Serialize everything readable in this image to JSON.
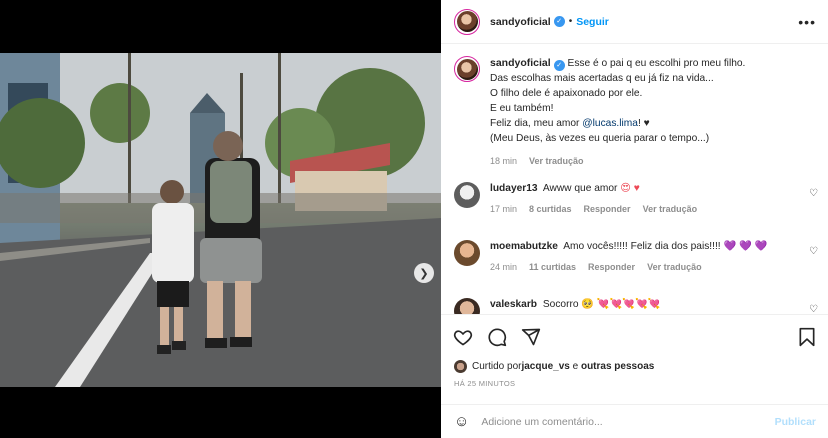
{
  "post": {
    "author": "sandyoficial",
    "follow_label": "Seguir",
    "separator": "•",
    "more_icon": "more-dots-icon"
  },
  "caption": {
    "username": "sandyoficial",
    "lines": [
      "Esse é o pai q eu escolhi pro meu filho.",
      "Das escolhas mais acertadas q eu já fiz na vida...",
      "O filho dele é apaixonado por ele.",
      "E eu também!",
      "(Meu Deus, às vezes eu queria parar o tempo...)"
    ],
    "feliz_prefix": "Feliz dia, meu amor ",
    "mention": "@lucas.lima",
    "feliz_suffix": "! ♥",
    "time": "18 min",
    "translate": "Ver tradução"
  },
  "comments": [
    {
      "username": "ludayer13",
      "text": "Awww que amor",
      "emojis": "😍 ♥",
      "time": "17 min",
      "likes": "8 curtidas",
      "reply": "Responder",
      "translate": "Ver tradução"
    },
    {
      "username": "moemabutzke",
      "text": "Amo vocês!!!!! Feliz dia dos pais!!!!",
      "emojis": "💜 💜 💜",
      "time": "24 min",
      "likes": "11 curtidas",
      "reply": "Responder",
      "translate": "Ver tradução"
    },
    {
      "username": "valeskarb",
      "text": "Socorro",
      "emojis": "🥺 💘💘💘💘💘"
    }
  ],
  "actions": {
    "liked_by_prefix": "Curtido por ",
    "liked_by_user": "jacque_vs",
    "liked_by_middle": " e ",
    "liked_by_others": "outras pessoas",
    "timestamp": "HÁ 25 MINUTOS"
  },
  "add_comment": {
    "placeholder": "Adicione um comentário...",
    "publish_label": "Publicar"
  },
  "carousel": {
    "current": 1,
    "total": 2
  },
  "colors": {
    "accent": "#0095f6",
    "verified": "#3897f0",
    "mention": "#00376b"
  }
}
